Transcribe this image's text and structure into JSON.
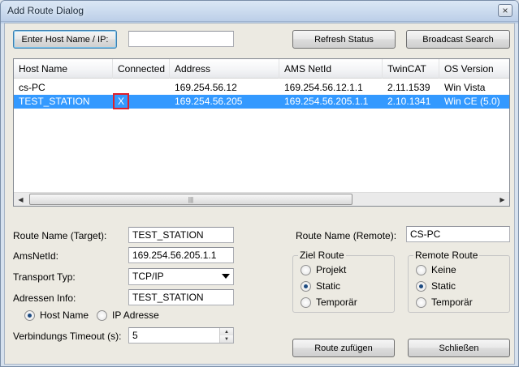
{
  "window": {
    "title": "Add Route Dialog",
    "close_glyph": "×"
  },
  "top": {
    "enter_host_label": "Enter Host Name / IP:",
    "host_value": "",
    "refresh_label": "Refresh Status",
    "broadcast_label": "Broadcast Search"
  },
  "list": {
    "columns": [
      "Host Name",
      "Connected",
      "Address",
      "AMS NetId",
      "TwinCAT",
      "OS Version"
    ],
    "rows": [
      {
        "host": "cs-PC",
        "connected": "",
        "address": "169.254.56.12",
        "netid": "169.254.56.12.1.1",
        "twincat": "2.11.1539",
        "os": "Win Vista"
      },
      {
        "host": "TEST_STATION",
        "connected": "X",
        "address": "169.254.56.205",
        "netid": "169.254.56.205.1.1",
        "twincat": "2.10.1341",
        "os": "Win CE (5.0)"
      }
    ],
    "scroll_thumb_glyph": "|||"
  },
  "form": {
    "route_name_target_label": "Route Name (Target):",
    "route_name_target_value": "TEST_STATION",
    "amsnetid_label": "AmsNetId:",
    "amsnetid_value": "169.254.56.205.1.1",
    "transport_label": "Transport Typ:",
    "transport_value": "TCP/IP",
    "adressen_label": "Adressen Info:",
    "adressen_value": "TEST_STATION",
    "radio_host_name": "Host Name",
    "radio_ip_adresse": "IP Adresse",
    "timeout_label": "Verbindungs Timeout (s):",
    "timeout_value": "5",
    "route_name_remote_label": "Route Name (Remote):",
    "route_name_remote_value": "CS-PC"
  },
  "ziel_route": {
    "title": "Ziel Route",
    "options": [
      "Projekt",
      "Static",
      "Temporär"
    ],
    "selected": "Static"
  },
  "remote_route": {
    "title": "Remote Route",
    "options": [
      "Keine",
      "Static",
      "Temporär"
    ],
    "selected": "Static"
  },
  "buttons": {
    "add_route": "Route zufügen",
    "close": "Schließen"
  }
}
